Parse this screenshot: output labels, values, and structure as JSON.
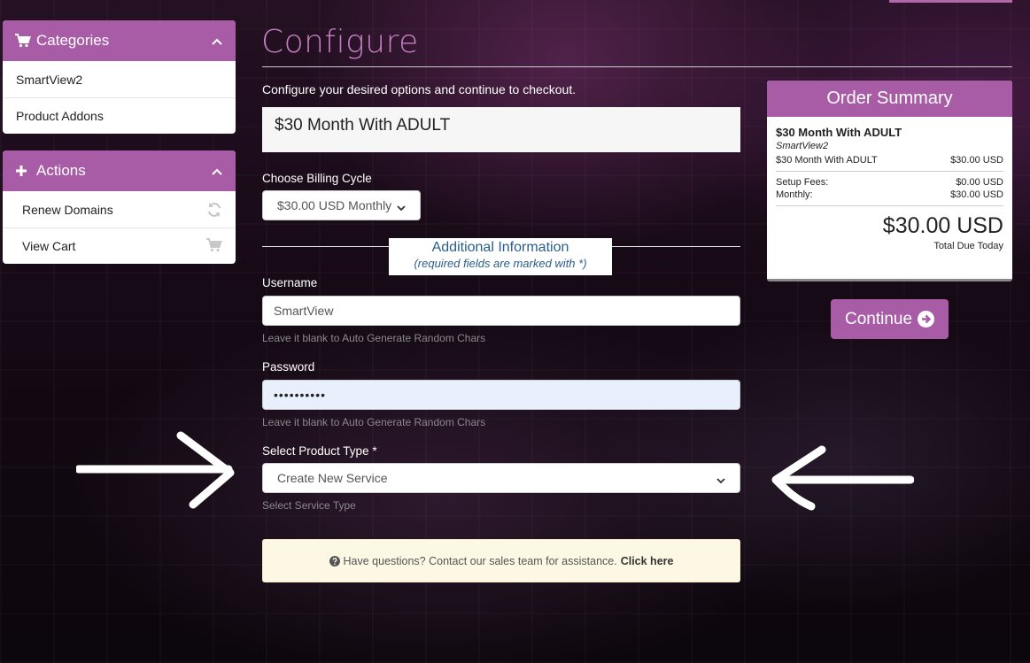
{
  "sidebar": {
    "categories": {
      "title": "Categories",
      "items": [
        "SmartView2",
        "Product Addons"
      ]
    },
    "actions": {
      "title": "Actions",
      "items": [
        "Renew Domains",
        "View Cart"
      ]
    }
  },
  "main": {
    "title": "Configure",
    "intro": "Configure your desired options and continue to checkout.",
    "product_name": "$30 Month With ADULT",
    "billing_label": "Choose Billing Cycle",
    "billing_value": "$30.00 USD Monthly",
    "additional_info_title": "Additional Information",
    "additional_info_sub": "(required fields are marked with *)",
    "username_label": "Username",
    "username_value": "SmartView",
    "username_help": "Leave it blank to Auto Generate Random Chars",
    "password_label": "Password",
    "password_value": "••••••••••",
    "password_help": "Leave it blank to Auto Generate Random Chars",
    "product_type_label": "Select Product Type *",
    "product_type_value": "Create New Service",
    "product_type_help": "Select Service Type",
    "assist_text": "Have questions? Contact our sales team for assistance.",
    "assist_link": "Click here"
  },
  "summary": {
    "title": "Order Summary",
    "product": "$30 Month With ADULT",
    "group": "SmartView2",
    "line_label": "$30 Month With ADULT",
    "line_value": "$30.00 USD",
    "setup_label": "Setup Fees:",
    "setup_value": "$0.00 USD",
    "monthly_label": "Monthly:",
    "monthly_value": "$30.00 USD",
    "total": "$30.00 USD",
    "total_label": "Total Due Today"
  },
  "continue_label": "Continue",
  "colors": {
    "accent": "#a95ca6",
    "title": "#c27ec0",
    "info_blue": "#2a5d8c"
  }
}
